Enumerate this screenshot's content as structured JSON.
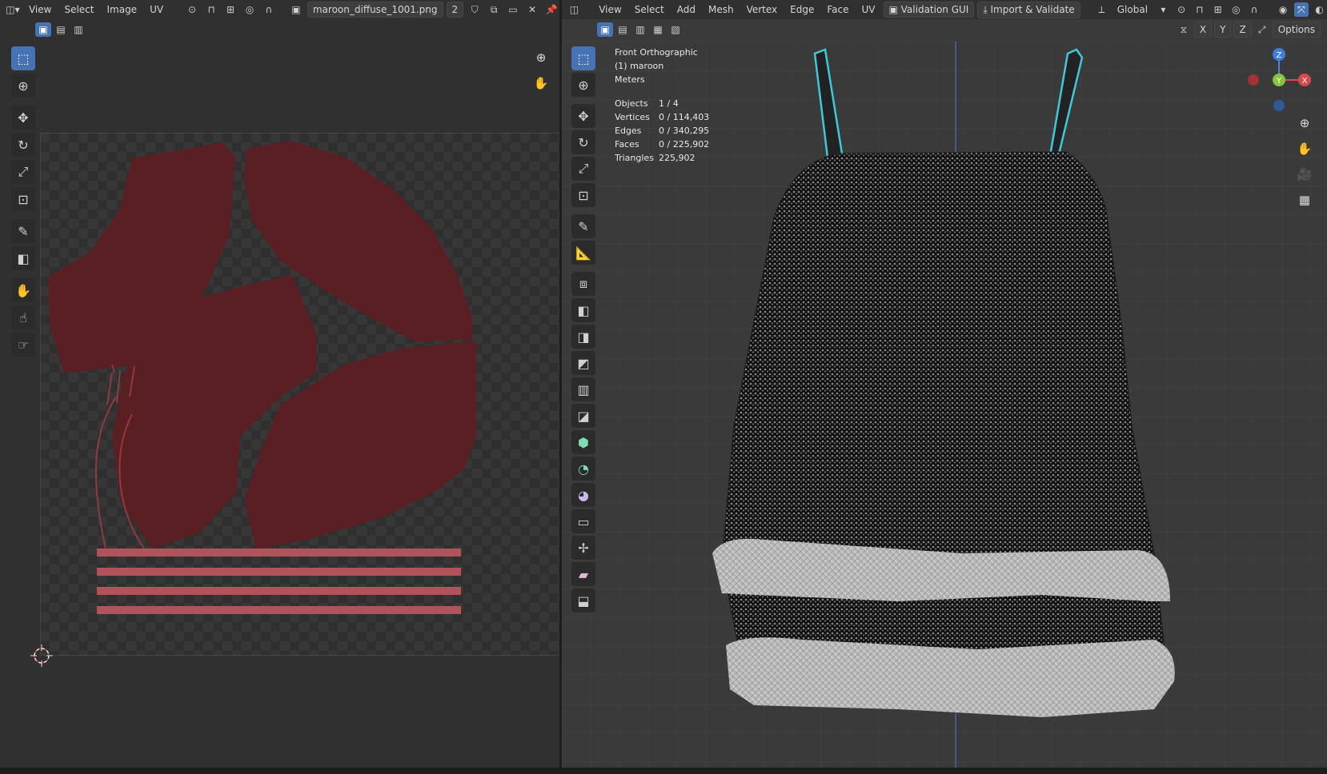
{
  "uv_editor": {
    "menu": [
      "View",
      "Select",
      "Image",
      "UV"
    ],
    "image_name": "maroon_diffuse_1001.png",
    "image_users": "2"
  },
  "viewport": {
    "menu": [
      "View",
      "Select",
      "Add",
      "Mesh",
      "Vertex",
      "Edge",
      "Face",
      "UV"
    ],
    "addon_buttons": [
      "Validation GUI",
      "Import & Validate"
    ],
    "transform_orientation": "Global",
    "axis_buttons": [
      "X",
      "Y",
      "Z"
    ],
    "options_label": "Options",
    "overlay": {
      "view_name": "Front Orthographic",
      "object_name": "(1) maroon",
      "units": "Meters"
    },
    "stats": [
      {
        "label": "Objects",
        "value": "1 / 4"
      },
      {
        "label": "Vertices",
        "value": "0 / 114,403"
      },
      {
        "label": "Edges",
        "value": "0 / 340,295"
      },
      {
        "label": "Faces",
        "value": "0 / 225,902"
      },
      {
        "label": "Triangles",
        "value": "225,902"
      }
    ],
    "gizmo_axes": [
      "Z",
      "Y",
      "X"
    ]
  },
  "colors": {
    "accent": "#4772b3",
    "uv_island": "#5a1f22",
    "uv_strip": "#b0545a",
    "seam": "#3ec8d8"
  }
}
